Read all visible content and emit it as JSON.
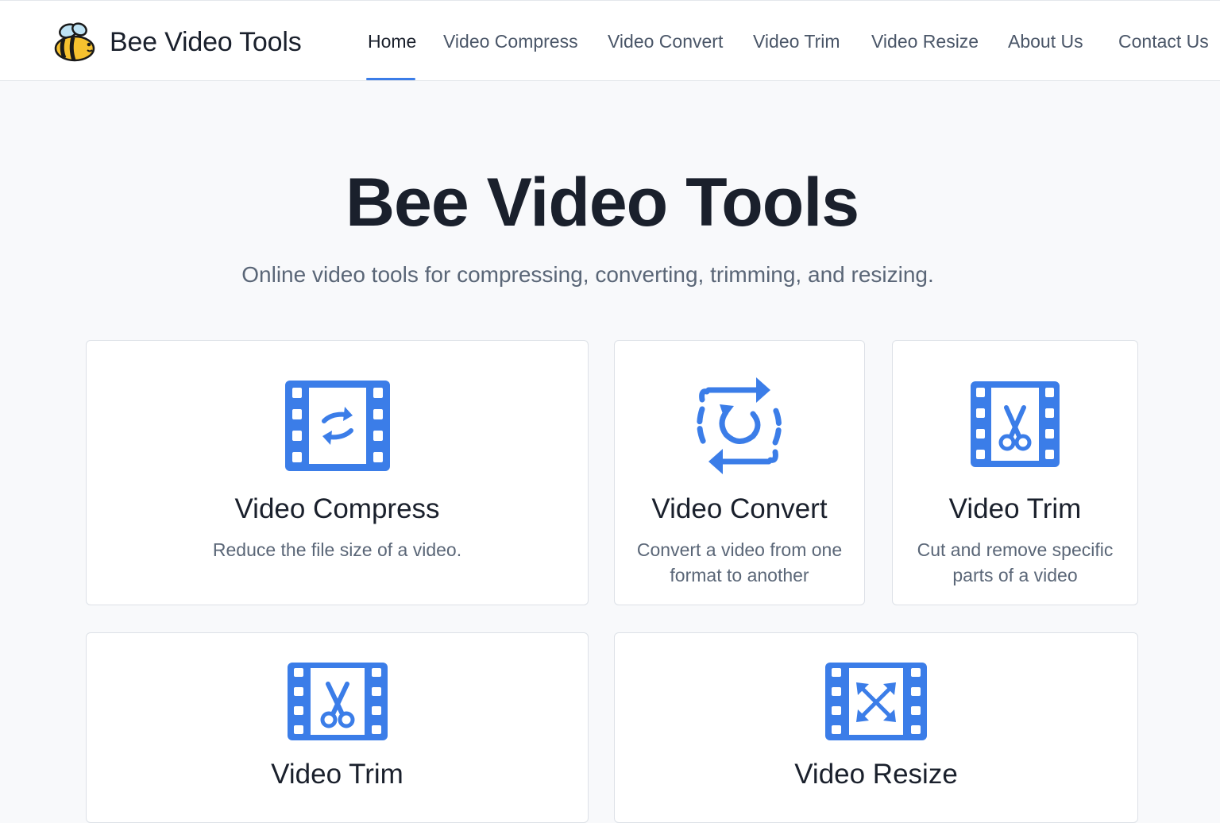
{
  "header": {
    "brand_name": "Bee Video Tools",
    "logo_icon": "bee-icon",
    "nav": [
      {
        "label": "Home",
        "active": true
      },
      {
        "label": "Video Compress",
        "active": false
      },
      {
        "label": "Video Convert",
        "active": false
      },
      {
        "label": "Video Trim",
        "active": false
      },
      {
        "label": "Video Resize",
        "active": false
      },
      {
        "label": "About Us",
        "active": false
      },
      {
        "label": "Contact Us",
        "active": false
      }
    ]
  },
  "hero": {
    "title": "Bee Video Tools",
    "subtitle": "Online video tools for compressing, converting, trimming, and resizing."
  },
  "cards": [
    {
      "title": "Video Compress",
      "description": "Reduce the file size of a video.",
      "icon": "film-swap-arrows-icon"
    },
    {
      "title": "Video Convert",
      "description": "Convert a video from one format to another",
      "icon": "convert-cycle-icon"
    },
    {
      "title": "Video Trim",
      "description": "Cut and remove specific parts of a video",
      "icon": "film-scissors-icon"
    },
    {
      "title": "Video Trim",
      "description": "",
      "icon": "film-scissors-icon"
    },
    {
      "title": "Video Resize",
      "description": "",
      "icon": "film-resize-arrows-icon"
    }
  ],
  "colors": {
    "accent": "#3b7de8",
    "heading": "#1a202c",
    "muted": "#5a6677",
    "background": "#f8f9fb",
    "border": "#dde1e7",
    "bee_yellow": "#f6c12f",
    "bee_wing": "#bfe3f4"
  }
}
